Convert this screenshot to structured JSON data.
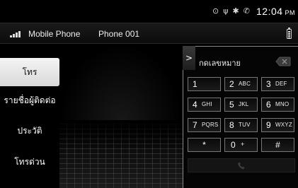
{
  "status_bar": {
    "icons": [
      "location-target-icon",
      "usb-icon",
      "bluetooth-icon",
      "phone-connected-icon"
    ],
    "time": "12:04",
    "ampm": "PM"
  },
  "header": {
    "source_label": "Mobile Phone",
    "device_name": "Phone 001"
  },
  "menu": {
    "items": [
      {
        "label": "โทร",
        "active": true
      },
      {
        "label": "รายชื่อผู้ติดต่อ",
        "active": false
      },
      {
        "label": "ประวัติ",
        "active": false
      },
      {
        "label": "โทรด่วน",
        "active": false
      }
    ]
  },
  "dialer": {
    "input_label": "กดเลขหมาย",
    "keys": [
      {
        "num": "1",
        "letters": ""
      },
      {
        "num": "2",
        "letters": "ABC"
      },
      {
        "num": "3",
        "letters": "DEF"
      },
      {
        "num": "4",
        "letters": "GHI"
      },
      {
        "num": "5",
        "letters": "JKL"
      },
      {
        "num": "6",
        "letters": "MNO"
      },
      {
        "num": "7",
        "letters": "PQRS"
      },
      {
        "num": "8",
        "letters": "TUV"
      },
      {
        "num": "9",
        "letters": "WXYZ"
      },
      {
        "num": "*",
        "letters": ""
      },
      {
        "num": "0",
        "letters": "+"
      },
      {
        "num": "#",
        "letters": ""
      }
    ],
    "collapse_glyph": ">"
  }
}
